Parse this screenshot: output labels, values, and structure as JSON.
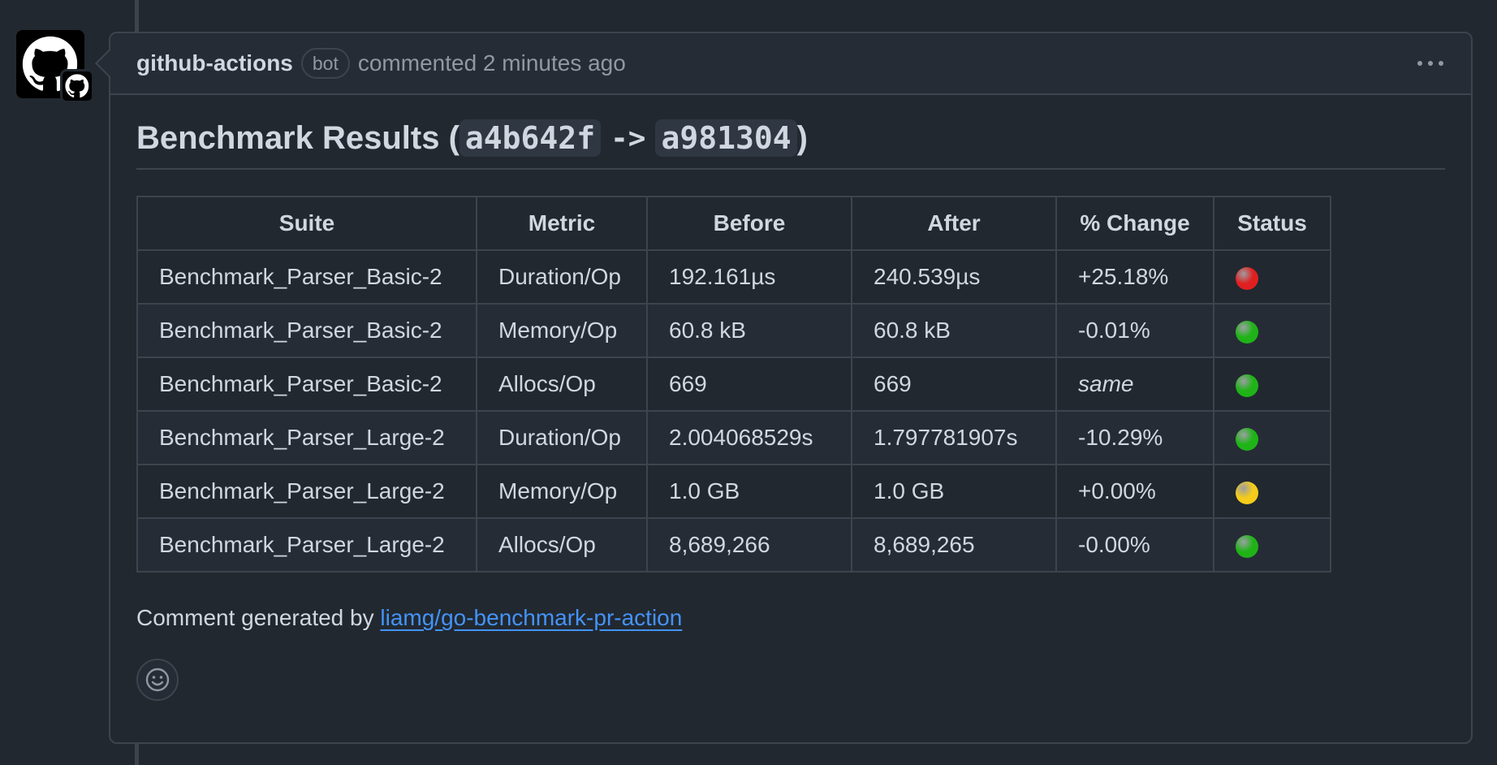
{
  "comment": {
    "author": "github-actions",
    "badge": "bot",
    "meta": "commented 2 minutes ago",
    "menu_icon": "kebab-horizontal-icon",
    "avatar_icon": "github-octocat-icon"
  },
  "body": {
    "title_prefix": "Benchmark Results (",
    "commit_before": "a4b642f",
    "arrow": "->",
    "commit_after": "a981304",
    "title_suffix": ")",
    "table": {
      "headers": [
        "Suite",
        "Metric",
        "Before",
        "After",
        "% Change",
        "Status"
      ],
      "rows": [
        {
          "suite": "Benchmark_Parser_Basic-2",
          "metric": "Duration/Op",
          "before": "192.161µs",
          "after": "240.539µs",
          "change": "+25.18%",
          "status": "red"
        },
        {
          "suite": "Benchmark_Parser_Basic-2",
          "metric": "Memory/Op",
          "before": "60.8 kB",
          "after": "60.8 kB",
          "change": "-0.01%",
          "status": "green"
        },
        {
          "suite": "Benchmark_Parser_Basic-2",
          "metric": "Allocs/Op",
          "before": "669",
          "after": "669",
          "change": "same",
          "status": "green"
        },
        {
          "suite": "Benchmark_Parser_Large-2",
          "metric": "Duration/Op",
          "before": "2.004068529s",
          "after": "1.797781907s",
          "change": "-10.29%",
          "status": "green"
        },
        {
          "suite": "Benchmark_Parser_Large-2",
          "metric": "Memory/Op",
          "before": "1.0 GB",
          "after": "1.0 GB",
          "change": "+0.00%",
          "status": "yellow"
        },
        {
          "suite": "Benchmark_Parser_Large-2",
          "metric": "Allocs/Op",
          "before": "8,689,266",
          "after": "8,689,265",
          "change": "-0.00%",
          "status": "green"
        }
      ]
    },
    "footer_prefix": "Comment generated by ",
    "footer_link": "liamg/go-benchmark-pr-action"
  },
  "status_colors": {
    "red": "#e02020",
    "green": "#1fb318",
    "yellow": "#f5cc1a"
  },
  "reaction_icon": "smiley-icon"
}
